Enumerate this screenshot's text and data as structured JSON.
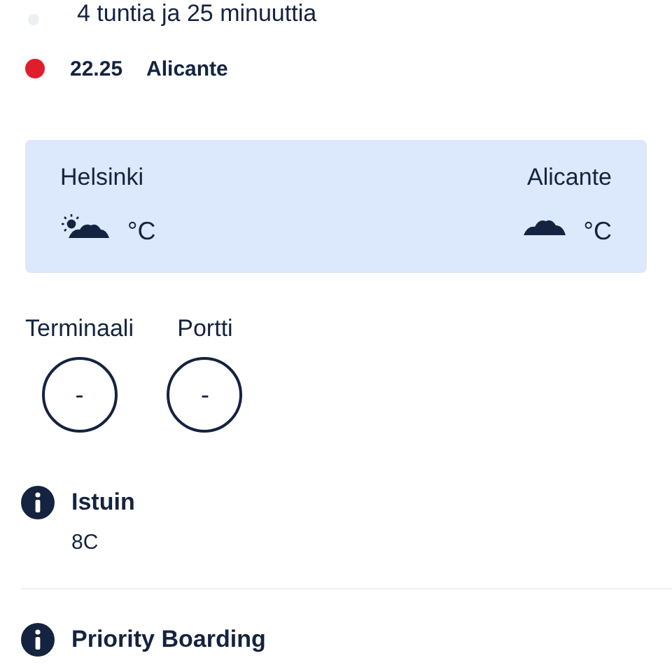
{
  "duration": "4 tuntia ja 25 minuuttia",
  "arrival": {
    "time": "22.25",
    "place": "Alicante",
    "color": "#e01e2b"
  },
  "weather": [
    {
      "city": "Helsinki",
      "kind": "sun-cloud",
      "unit": "°C"
    },
    {
      "city": "Alicante",
      "kind": "cloud",
      "unit": "°C"
    }
  ],
  "gates": [
    {
      "label": "Terminaali",
      "value": "-"
    },
    {
      "label": "Portti",
      "value": "-"
    }
  ],
  "info": [
    {
      "title": "Istuin",
      "value": "8C"
    },
    {
      "title": "Priority Boarding"
    }
  ]
}
